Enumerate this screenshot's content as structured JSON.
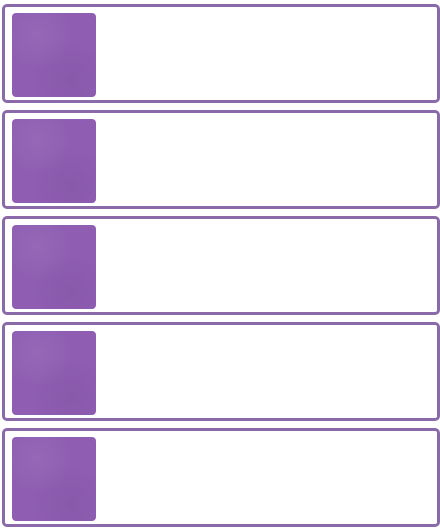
{
  "colors": {
    "border": "#8a6aa8",
    "thumbnail": "#8f5eb2",
    "background": "#ffffff"
  },
  "list": {
    "items": [
      {
        "thumbnail": "purple-thumbnail"
      },
      {
        "thumbnail": "purple-thumbnail"
      },
      {
        "thumbnail": "purple-thumbnail"
      },
      {
        "thumbnail": "purple-thumbnail"
      },
      {
        "thumbnail": "purple-thumbnail"
      }
    ]
  }
}
